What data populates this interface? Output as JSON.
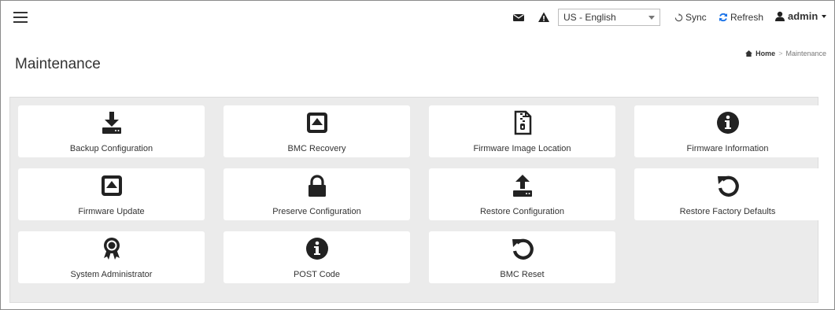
{
  "topbar": {
    "language": "US - English",
    "sync_label": "Sync",
    "refresh_label": "Refresh",
    "user": "admin"
  },
  "page": {
    "title": "Maintenance",
    "breadcrumb": {
      "home": "Home",
      "current": "Maintenance"
    }
  },
  "tiles": [
    {
      "label": "Backup Configuration",
      "icon": "download-drive-icon"
    },
    {
      "label": "BMC Recovery",
      "icon": "eject-square-icon"
    },
    {
      "label": "Firmware Image Location",
      "icon": "zip-file-icon"
    },
    {
      "label": "Firmware Information",
      "icon": "info-circle-icon"
    },
    {
      "label": "Firmware Update",
      "icon": "eject-square-icon"
    },
    {
      "label": "Preserve Configuration",
      "icon": "lock-icon"
    },
    {
      "label": "Restore Configuration",
      "icon": "upload-drive-icon"
    },
    {
      "label": "Restore Factory Defaults",
      "icon": "undo-icon"
    },
    {
      "label": "System Administrator",
      "icon": "award-icon"
    },
    {
      "label": "POST Code",
      "icon": "info-circle-icon"
    },
    {
      "label": "BMC Reset",
      "icon": "undo-icon"
    }
  ]
}
